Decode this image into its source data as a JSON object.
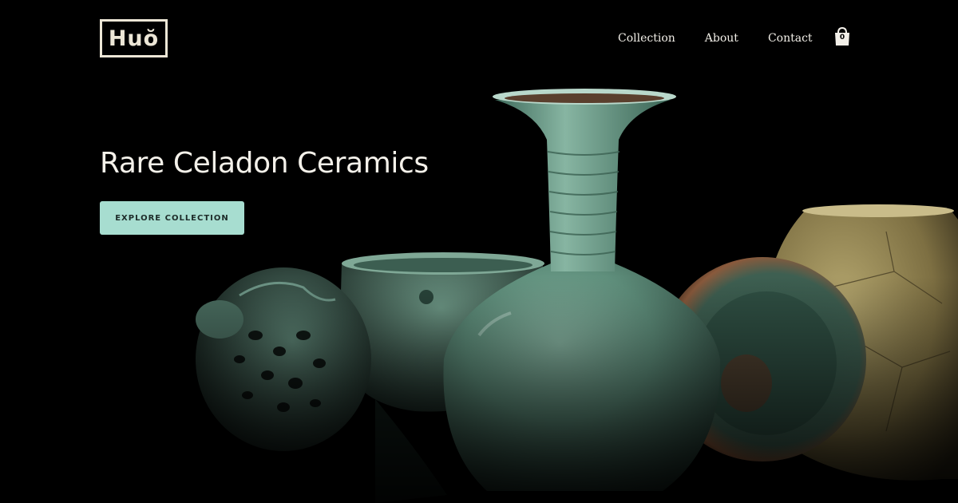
{
  "brand": {
    "logo_text": "Huŏ"
  },
  "nav": {
    "items": [
      {
        "label": "Collection"
      },
      {
        "label": "About"
      },
      {
        "label": "Contact"
      }
    ]
  },
  "cart": {
    "count": "0",
    "icon": "shopping-bag-icon"
  },
  "hero": {
    "title": "Rare Celadon Ceramics",
    "cta_label": "EXPLORE COLLECTION"
  },
  "colors": {
    "background": "#000000",
    "accent": "#a7ddd0",
    "text": "#f4f1ea",
    "celadon": "#5f8f7c"
  }
}
